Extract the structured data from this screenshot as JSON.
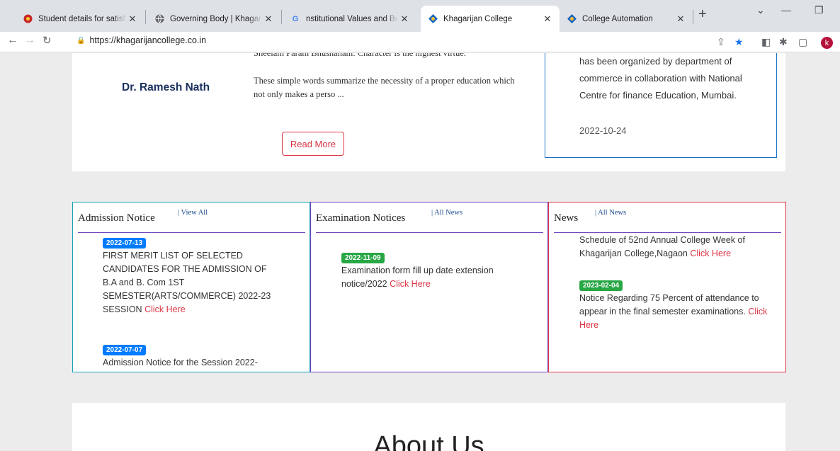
{
  "browser": {
    "tabs": [
      {
        "title": "Student details for satisfactio",
        "icon": "red-flower-icon"
      },
      {
        "title": "Governing Body | Khagarijan",
        "icon": "globe-icon"
      },
      {
        "title": "nstitutional Values and Best P",
        "icon": "google-icon"
      },
      {
        "title": "Khagarijan College",
        "icon": "college-logo-icon",
        "active": true
      },
      {
        "title": "College Automation",
        "icon": "college-logo-icon"
      }
    ],
    "new_tab": "+",
    "url": "https://khagarijancollege.co.in",
    "profile_initial": "k"
  },
  "principal": {
    "name": "Dr. Ramesh Nath",
    "quote_cut": "Sheelam Param Bhushanam: Character is the highest virtue.",
    "quote": "These simple words summarize the necessity of a proper education which not only makes a perso ...",
    "read_more": "Read More"
  },
  "event": {
    "text": "has been organized by department of commerce in collaboration with National Centre for finance Education, Mumbai.",
    "date": "2022-10-24"
  },
  "admission": {
    "title": "Admission Notice",
    "view": "| View All",
    "items": [
      {
        "date": "2022-07-13",
        "text": "FIRST MERIT LIST OF SELECTED CANDIDATES FOR THE ADMISSION OF B.A and B. Com 1ST SEMESTER(ARTS/COMMERCE) 2022-23 SESSION",
        "link": "Click Here"
      },
      {
        "date": "2022-07-07",
        "text": "Admission Notice for the Session 2022-"
      }
    ]
  },
  "exam": {
    "title": "Examination Notices",
    "view": "| All News",
    "items": [
      {
        "date": "2022-11-09",
        "text": "Examination form fill up date extension notice/2022",
        "link": "Click Here"
      }
    ]
  },
  "news": {
    "title": "News",
    "view": "| All News",
    "items": [
      {
        "text": "Schedule of 52nd Annual College Week of Khagarijan College,Nagaon",
        "link": "Click Here"
      },
      {
        "date": "2023-02-04",
        "text": "Notice Regarding 75 Percent of attendance to appear in the final semester examinations.",
        "link": "Click Here"
      }
    ]
  },
  "about": {
    "title": "About Us"
  },
  "colors": {
    "primary_link": "#dc3545",
    "badge_blue": "#007bff",
    "badge_green": "#28a745"
  }
}
